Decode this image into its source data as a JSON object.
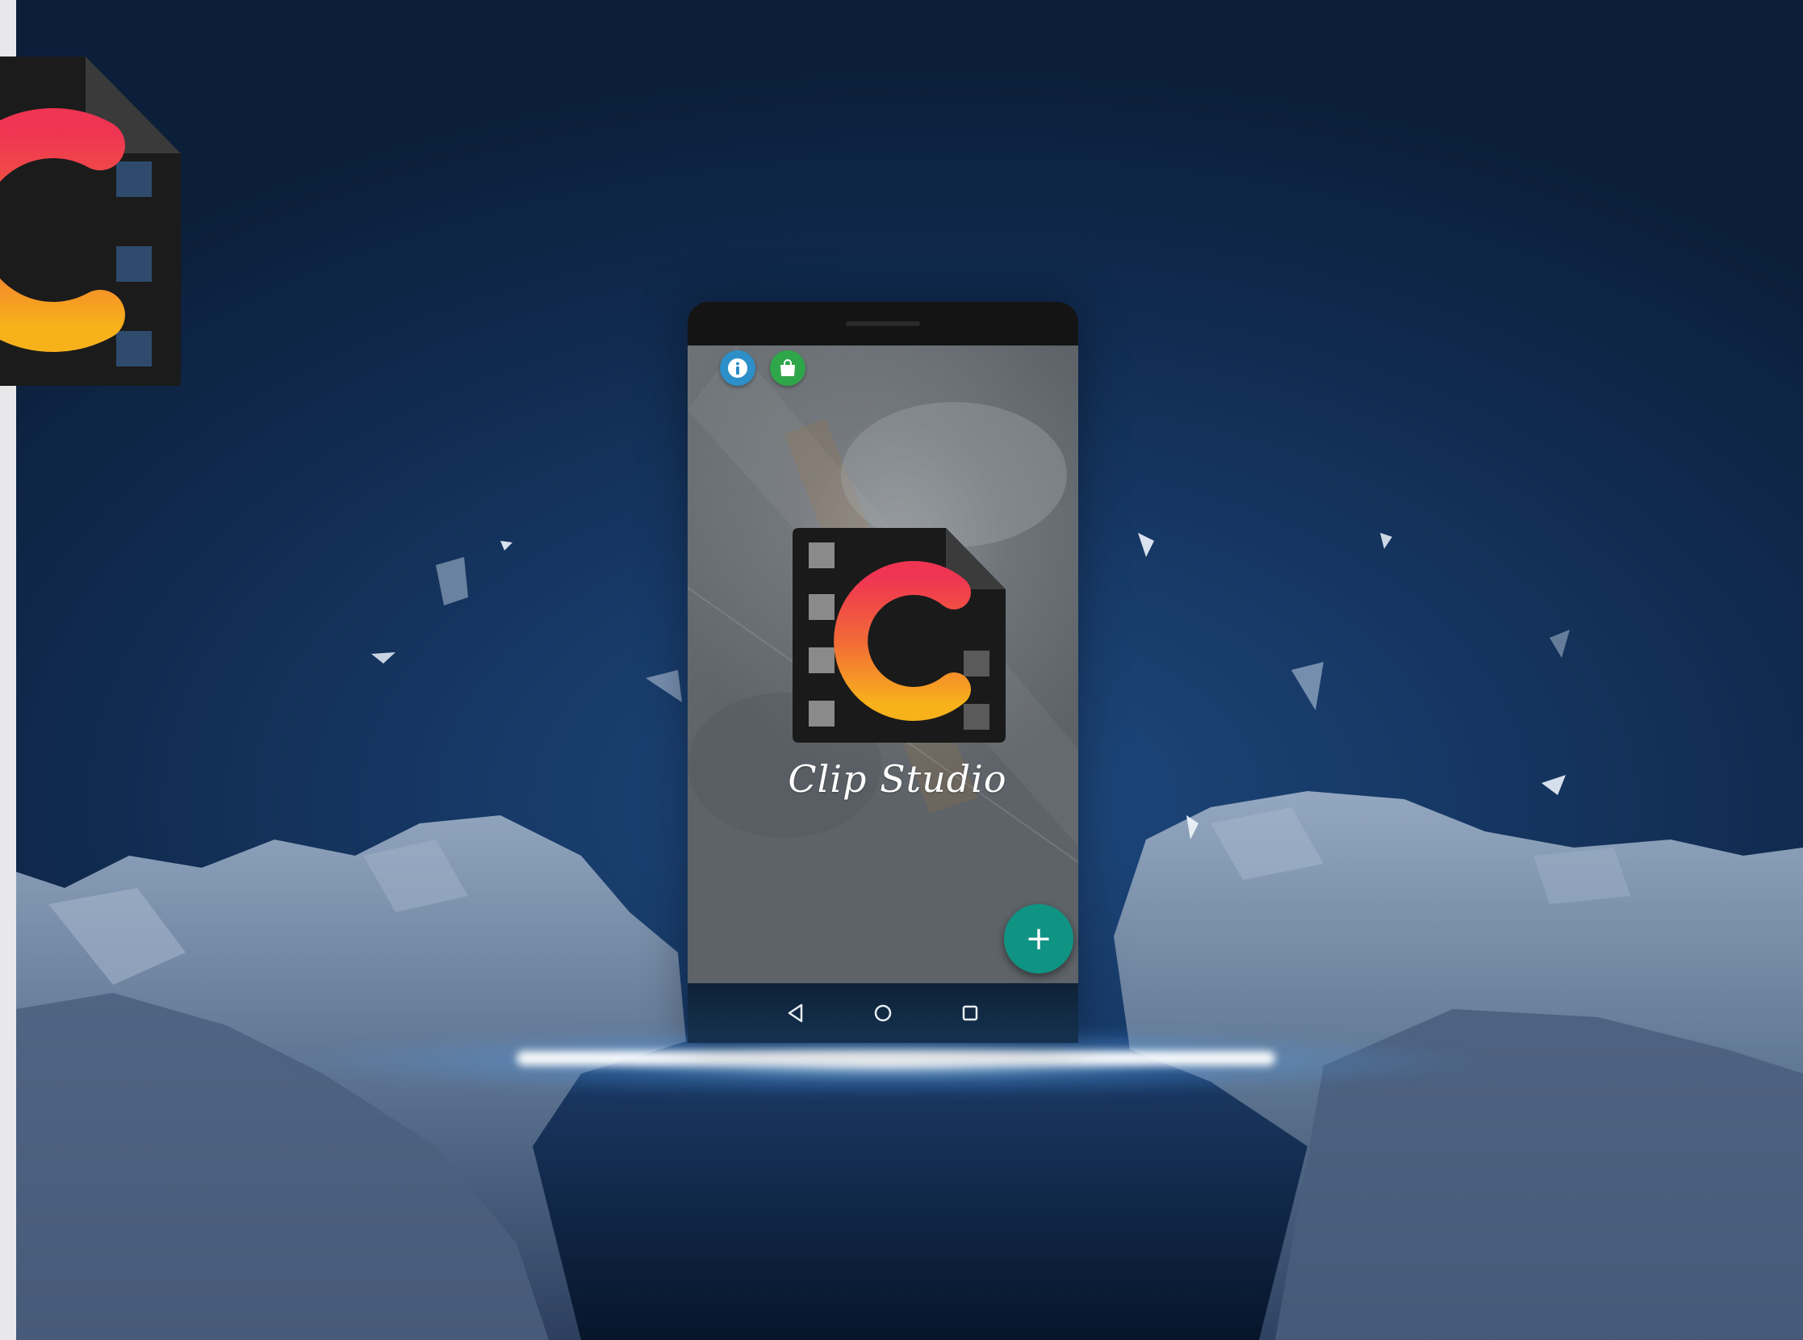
{
  "app": {
    "name": "Clip Studio"
  },
  "buttons": {
    "info_icon": "info-icon",
    "shop_icon": "shopping-bag-icon",
    "add_label": "+"
  },
  "nav": {
    "back_icon": "back-triangle-icon",
    "home_icon": "home-circle-icon",
    "recents_icon": "recents-square-icon"
  },
  "colors": {
    "background": "#102a4e",
    "info_button": "#2d8fc7",
    "shop_button": "#2fa64a",
    "fab": "#0f9484",
    "logo_red": "#ef3552",
    "logo_orange": "#f7a21b"
  }
}
